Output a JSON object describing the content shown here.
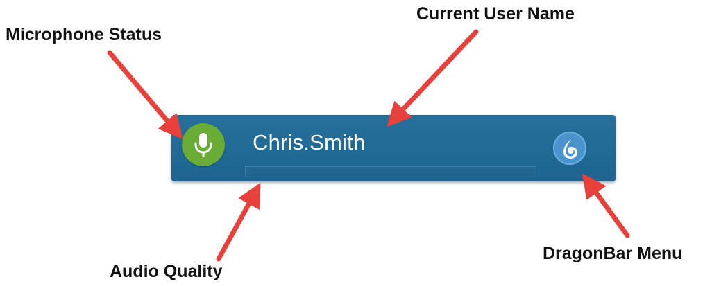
{
  "annotations": {
    "microphone_status": "Microphone Status",
    "current_user_name": "Current User Name",
    "audio_quality": "Audio Quality",
    "dragonbar_menu": "DragonBar Menu"
  },
  "dragonbar": {
    "user_name": "Chris.Smith",
    "mic_icon": "microphone-icon",
    "menu_icon": "dragon-logo-icon",
    "audio_level": 0,
    "colors": {
      "bar": "#1f6a95",
      "mic_active": "#6aad36",
      "menu_button": "#4a93cc",
      "arrow": "#e8413b"
    }
  }
}
